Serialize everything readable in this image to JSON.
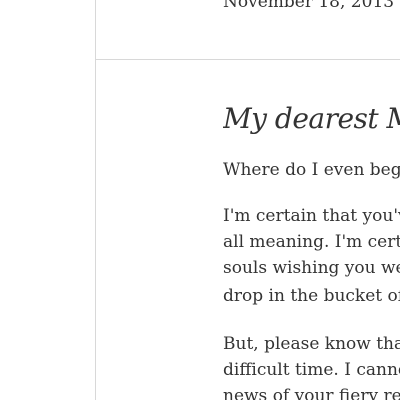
{
  "letter": {
    "date": "November 18, 2013",
    "salutation": "My dearest M",
    "lines": [
      "Where do I even begi",
      "I'm certain that you'v",
      "all meaning. I'm certa",
      "souls wishing you wel",
      "drop in the bucket of",
      "But, please know that",
      "difficult time. I canno",
      "news of your fiery res"
    ]
  }
}
